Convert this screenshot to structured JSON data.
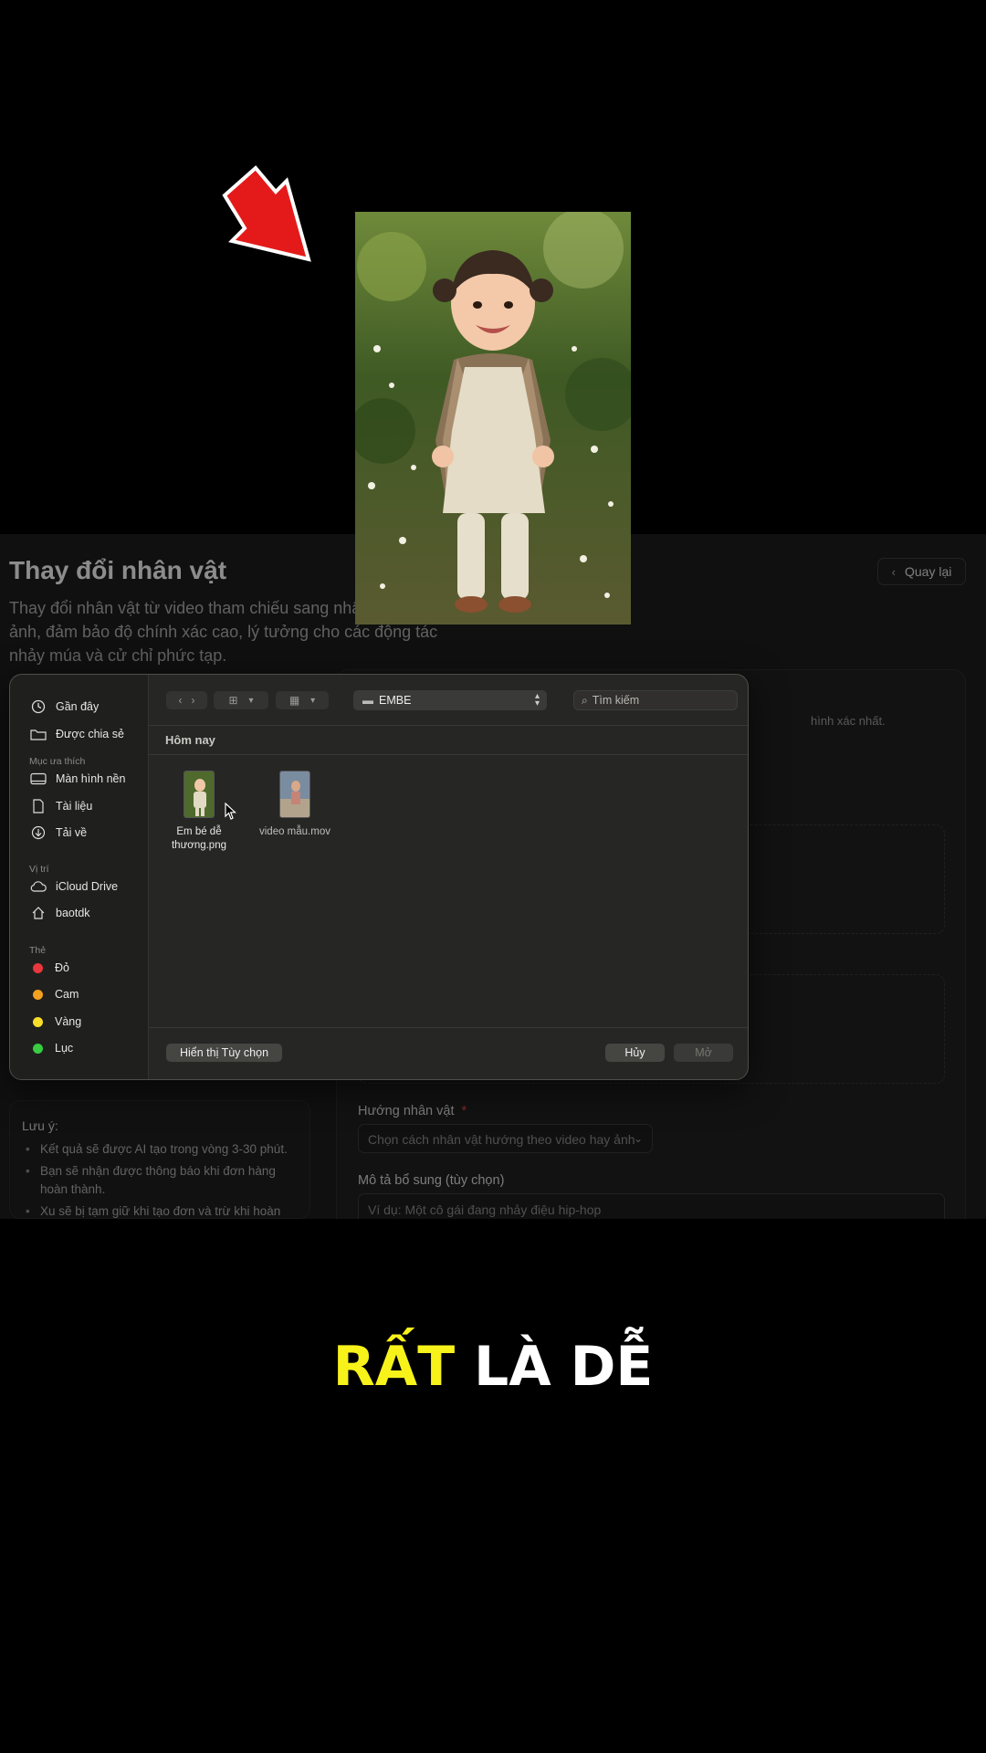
{
  "page": {
    "title": "Thay đổi nhân vật",
    "description": "Thay đổi nhân vật từ video tham chiếu sang nhân vật trong ảnh, đảm bảo độ chính xác cao, lý tưởng cho các động tác nhảy múa và cử chỉ phức tạp.",
    "back_label": "Quay lại",
    "hint_fragment": "hình xác nhất.",
    "notes_title": "Lưu ý:",
    "notes": [
      "Kết quả sẽ được AI tạo trong vòng 3-30 phút.",
      "Bạn sẽ nhận được thông báo khi đơn hàng hoàn thành.",
      "Xu sẽ bị tạm giữ khi tạo đơn và trừ khi hoàn"
    ],
    "direction_label": "Hướng nhân vật",
    "direction_required": "*",
    "direction_placeholder": "Chọn cách nhân vật hướng theo video hay ảnh",
    "extra_label": "Mô tả bổ sung (tùy chọn)",
    "extra_placeholder": "Ví dụ: Một cô gái đang nhảy điệu hip-hop"
  },
  "dialog": {
    "sidebar": {
      "items_top": [
        {
          "label": "Gần đây",
          "icon": "clock-icon"
        },
        {
          "label": "Được chia sẻ",
          "icon": "shared-folder-icon"
        }
      ],
      "favorites_title": "Mục ưa thích",
      "favorites": [
        {
          "label": "Màn hình nền",
          "icon": "desktop-icon"
        },
        {
          "label": "Tài liệu",
          "icon": "document-icon"
        },
        {
          "label": "Tải về",
          "icon": "download-icon"
        }
      ],
      "locations_title": "Vị trí",
      "locations": [
        {
          "label": "iCloud Drive",
          "icon": "cloud-icon"
        },
        {
          "label": "baotdk",
          "icon": "home-icon"
        }
      ],
      "tags_title": "Thẻ",
      "tags": [
        {
          "label": "Đỏ",
          "color": "#e8383d"
        },
        {
          "label": "Cam",
          "color": "#f4a020"
        },
        {
          "label": "Vàng",
          "color": "#f8de2a"
        },
        {
          "label": "Lục",
          "color": "#38cc40"
        }
      ]
    },
    "folder": "EMBE",
    "search_placeholder": "Tìm kiếm",
    "group": "Hôm nay",
    "files": [
      {
        "name": "Em bé dễ thương.png",
        "dim": false
      },
      {
        "name": "video mẫu.mov",
        "dim": true
      }
    ],
    "options_label": "Hiển thị Tùy chọn",
    "cancel_label": "Hủy",
    "open_label": "Mở"
  },
  "caption": {
    "highlight": "RẤT",
    "rest": "LÀ DỄ",
    "highlight_color": "#f7f21a"
  }
}
